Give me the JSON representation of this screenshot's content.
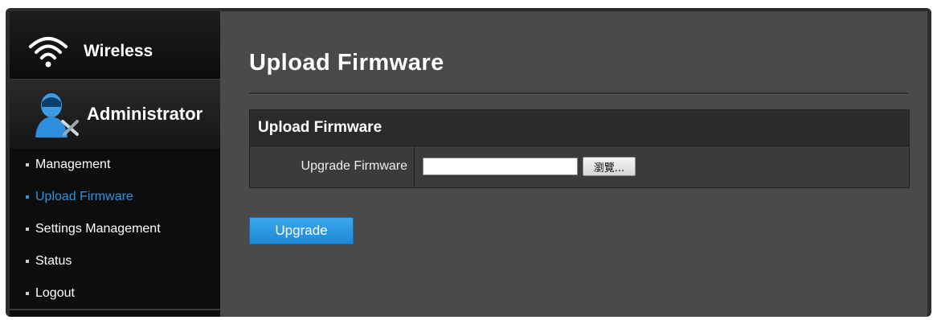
{
  "sidebar": {
    "wireless_label": "Wireless",
    "admin_label": "Administrator",
    "items": [
      {
        "label": "Management",
        "active": false
      },
      {
        "label": "Upload Firmware",
        "active": true
      },
      {
        "label": "Settings Management",
        "active": false
      },
      {
        "label": "Status",
        "active": false
      },
      {
        "label": "Logout",
        "active": false
      }
    ]
  },
  "main": {
    "title": "Upload Firmware",
    "panel": {
      "heading": "Upload Firmware",
      "row_label": "Upgrade Firmware",
      "file_value": "",
      "browse_label": "瀏覽..."
    },
    "upgrade_label": "Upgrade"
  },
  "colors": {
    "accent": "#2f93e0",
    "button": "#2a98e3",
    "panel_header": "#2b2b2d",
    "main_bg": "#4a4a4d",
    "sidebar_bg": "#0d0d0d"
  },
  "icons": [
    "wifi-icon",
    "administrator-icon"
  ]
}
